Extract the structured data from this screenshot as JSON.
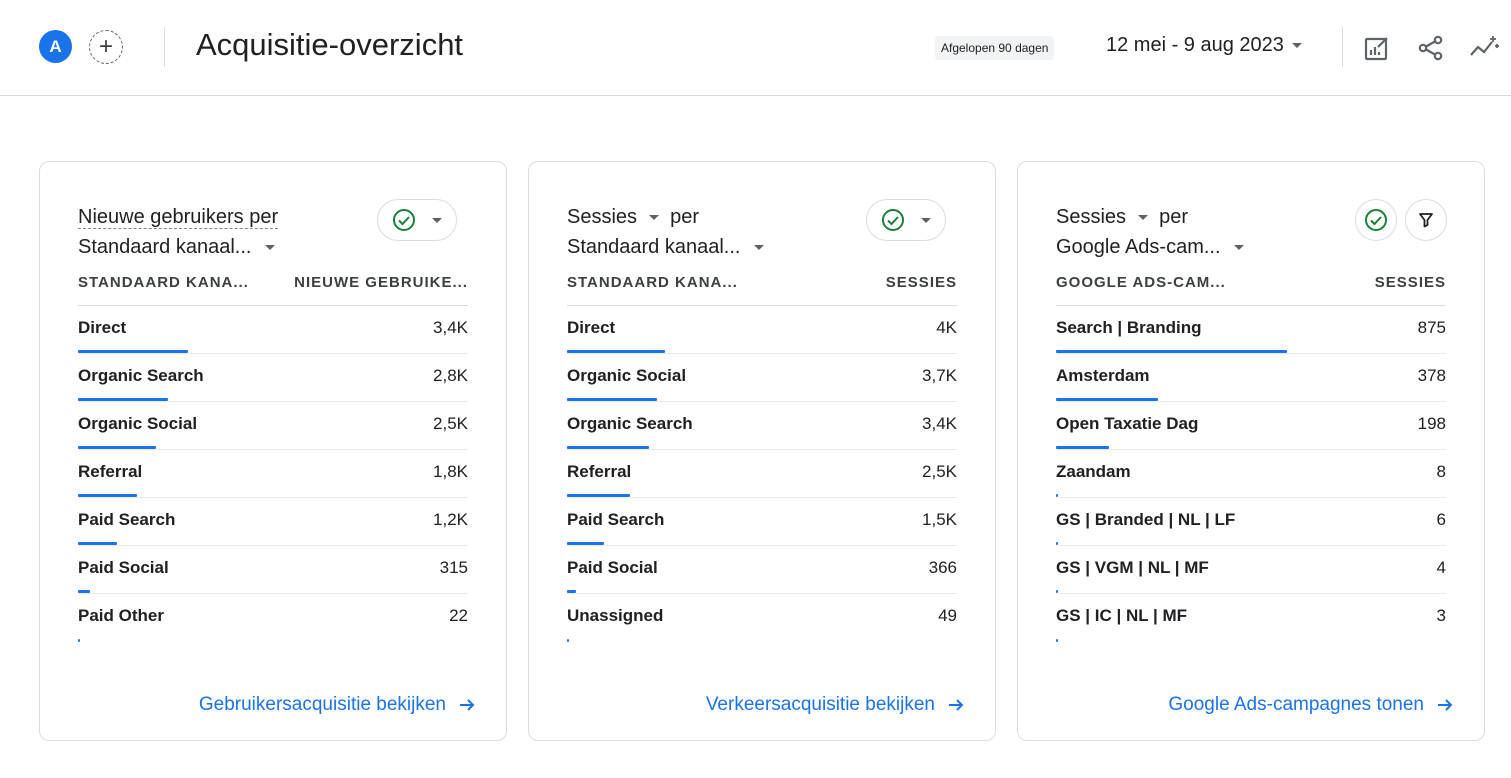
{
  "header": {
    "avatar_letter": "A",
    "add_label": "+",
    "title": "Acquisitie-overzicht",
    "period_chip": "Afgelopen 90 dagen",
    "date_range": "12 mei - 9 aug 2023",
    "icons": [
      "edit-report-icon",
      "share-icon",
      "insights-sparkline-icon"
    ]
  },
  "colors": {
    "accent": "#1a73e8",
    "check_green": "#188038",
    "border": "#dadce0"
  },
  "cards": [
    {
      "title_line1": "Nieuwe gebruikers per",
      "title_line2": "Standaard kanaal...",
      "col_left": "STANDAARD KANA...",
      "col_right": "NIEUWE GEBRUIKE...",
      "rows": [
        {
          "label": "Direct",
          "value": "3,4K",
          "fraction": 0.28
        },
        {
          "label": "Organic Search",
          "value": "2,8K",
          "fraction": 0.23
        },
        {
          "label": "Organic Social",
          "value": "2,5K",
          "fraction": 0.2
        },
        {
          "label": "Referral",
          "value": "1,8K",
          "fraction": 0.15
        },
        {
          "label": "Paid Search",
          "value": "1,2K",
          "fraction": 0.1
        },
        {
          "label": "Paid Social",
          "value": "315",
          "fraction": 0.03
        },
        {
          "label": "Paid Other",
          "value": "22",
          "fraction": 0.005
        }
      ],
      "link": "Gebruikersacquisitie bekijken"
    },
    {
      "title_line1": "Sessies",
      "title_line1_suffix": "per",
      "title_line2": "Standaard kanaal...",
      "col_left": "STANDAARD KANA...",
      "col_right": "SESSIES",
      "rows": [
        {
          "label": "Direct",
          "value": "4K",
          "fraction": 0.25
        },
        {
          "label": "Organic Social",
          "value": "3,7K",
          "fraction": 0.23
        },
        {
          "label": "Organic Search",
          "value": "3,4K",
          "fraction": 0.21
        },
        {
          "label": "Referral",
          "value": "2,5K",
          "fraction": 0.16
        },
        {
          "label": "Paid Search",
          "value": "1,5K",
          "fraction": 0.095
        },
        {
          "label": "Paid Social",
          "value": "366",
          "fraction": 0.023
        },
        {
          "label": "Unassigned",
          "value": "49",
          "fraction": 0.005
        }
      ],
      "link": "Verkeersacquisitie bekijken"
    },
    {
      "title_line1": "Sessies",
      "title_line1_suffix": "per",
      "title_line2": "Google Ads-cam...",
      "col_left": "GOOGLE ADS-CAM...",
      "col_right": "SESSIES",
      "rows": [
        {
          "label": "Search | Branding",
          "value": "875",
          "fraction": 0.59
        },
        {
          "label": "Amsterdam",
          "value": "378",
          "fraction": 0.26
        },
        {
          "label": "Open Taxatie Dag",
          "value": "198",
          "fraction": 0.135
        },
        {
          "label": "Zaandam",
          "value": "8",
          "fraction": 0.005
        },
        {
          "label": "GS | Branded | NL | LF",
          "value": "6",
          "fraction": 0.004
        },
        {
          "label": "GS | VGM | NL | MF",
          "value": "4",
          "fraction": 0.003
        },
        {
          "label": "GS | IC | NL | MF",
          "value": "3",
          "fraction": 0.002
        }
      ],
      "link": "Google Ads-campagnes tonen"
    }
  ]
}
